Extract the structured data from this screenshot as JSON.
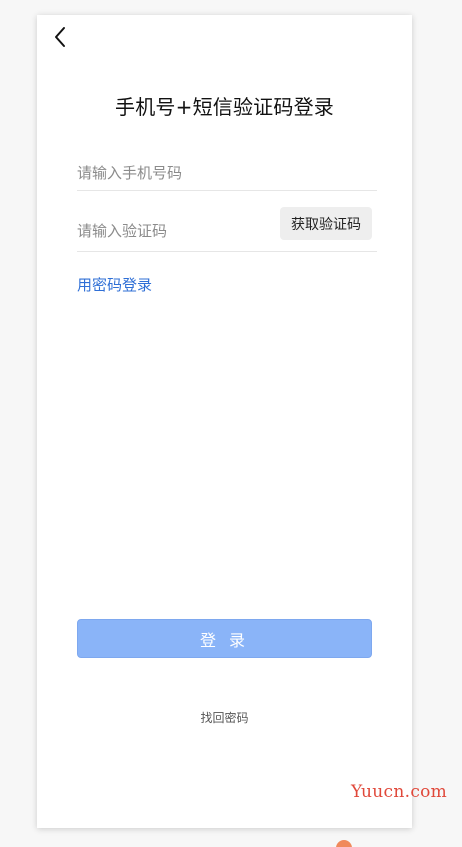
{
  "header": {
    "back_icon": "chevron-left-icon",
    "title": "手机号+短信验证码登录"
  },
  "form": {
    "phone": {
      "value": "",
      "placeholder": "请输入手机号码"
    },
    "code": {
      "value": "",
      "placeholder": "请输入验证码",
      "get_code_label": "获取验证码"
    },
    "password_login_link": "用密码登录",
    "login_button_label": "登 录",
    "find_password_link": "找回密码"
  },
  "watermark": "Yuucn.com",
  "colors": {
    "link": "#2f6fd6",
    "login_button": "#8ab4f8",
    "code_button_bg": "#eeeeee",
    "watermark": "#e0483a"
  }
}
